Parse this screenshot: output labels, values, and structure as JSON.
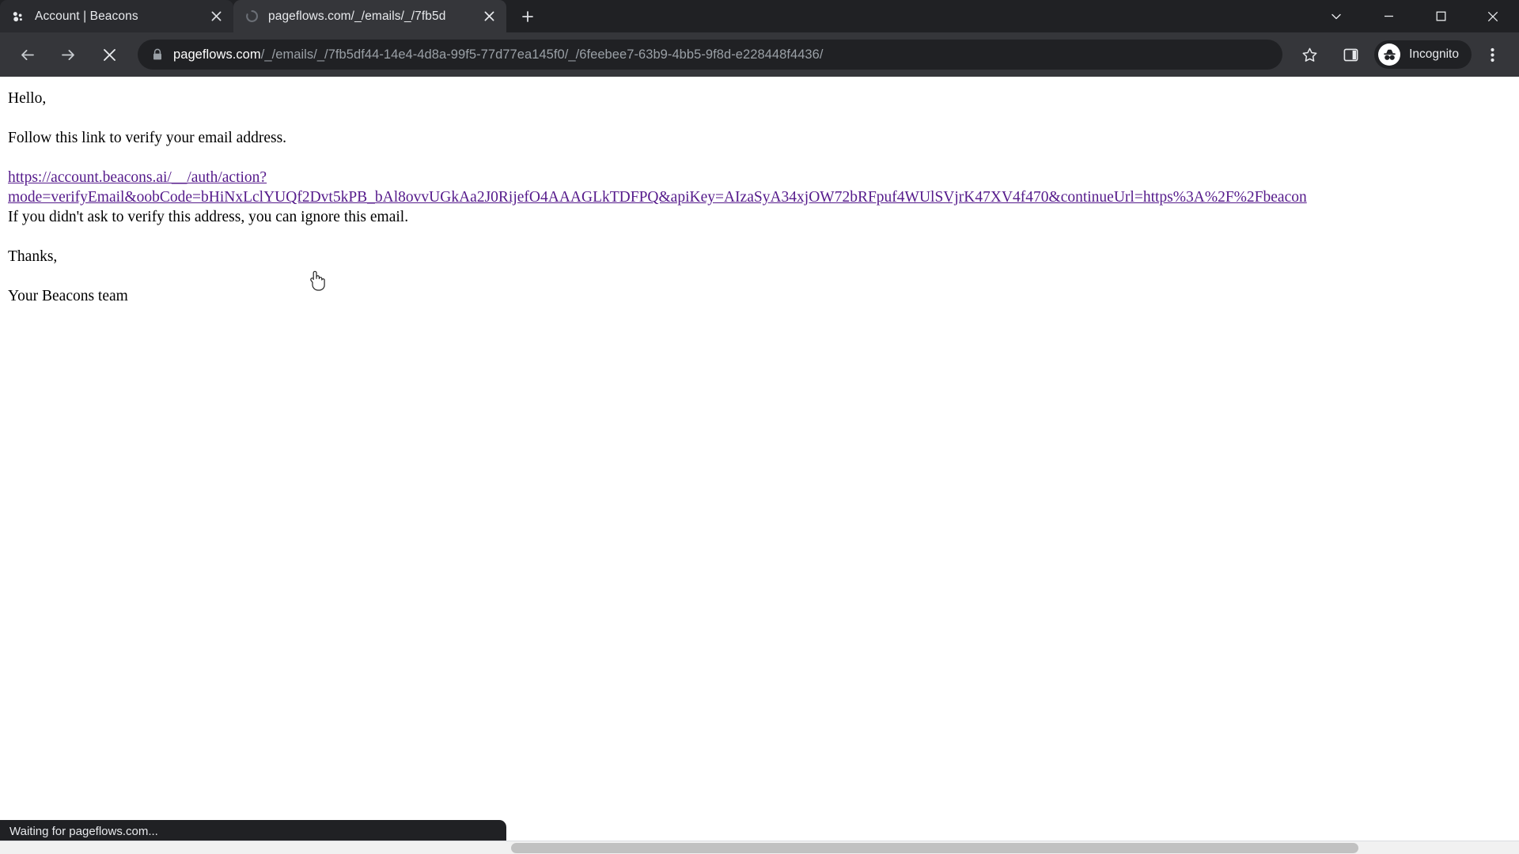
{
  "window": {
    "controls": {
      "list_tabs_label": "list-all-tabs",
      "minimize_label": "minimize",
      "maximize_label": "maximize",
      "close_label": "close"
    }
  },
  "tabstrip": {
    "tabs": [
      {
        "title": "Account | Beacons",
        "favicon": "beacons-logo-icon",
        "active": false,
        "loading": false,
        "close_label": "close-tab"
      },
      {
        "title": "pageflows.com/_/emails/_/7fb5d",
        "favicon": "loading-spinner-icon",
        "active": true,
        "loading": true,
        "close_label": "close-tab"
      }
    ],
    "new_tab_label": "New tab"
  },
  "toolbar": {
    "back_label": "Back",
    "forward_label": "Forward",
    "stop_label": "Stop loading this page",
    "bookmark_label": "Bookmark this tab",
    "side_panel_label": "Show side panel",
    "menu_label": "Customize and control Google Chrome",
    "incognito_label": "Incognito",
    "lock_icon": "lock-icon",
    "url": {
      "host": "pageflows.com",
      "path": "/_/emails/_/7fb5df44-14e4-4d8a-99f5-77d77ea145f0/_/6feebee7-63b9-4bb5-9f8d-e228448f4436/"
    }
  },
  "page": {
    "greeting": "Hello,",
    "instruction": "Follow this link to verify your email address.",
    "link": {
      "line1": "https://account.beacons.ai/__/auth/action?",
      "line2": "mode=verifyEmail&oobCode=bHiNxLclYUQf2Dvt5kPB_bAl8ovvUGkAa2J0RijefO4AAAGLkTDFPQ&apiKey=AIzaSyA34xjOW72bRFpuf4WUlSVjrK47XV4f470&continueUrl=https%3A%2F%2Fbeacon"
    },
    "ignore_note": "If you didn't ask to verify this address, you can ignore this email.",
    "thanks": "Thanks,",
    "signature": "Your Beacons team"
  },
  "status": {
    "text": "Waiting for pageflows.com..."
  },
  "colors": {
    "chrome_tabstrip": "#202124",
    "chrome_toolbar": "#35363a",
    "active_tab": "#35363a",
    "omnibox": "#202124",
    "link": "#551a8b",
    "text": "#000000",
    "scrollbar_thumb": "#c1c1c1"
  }
}
